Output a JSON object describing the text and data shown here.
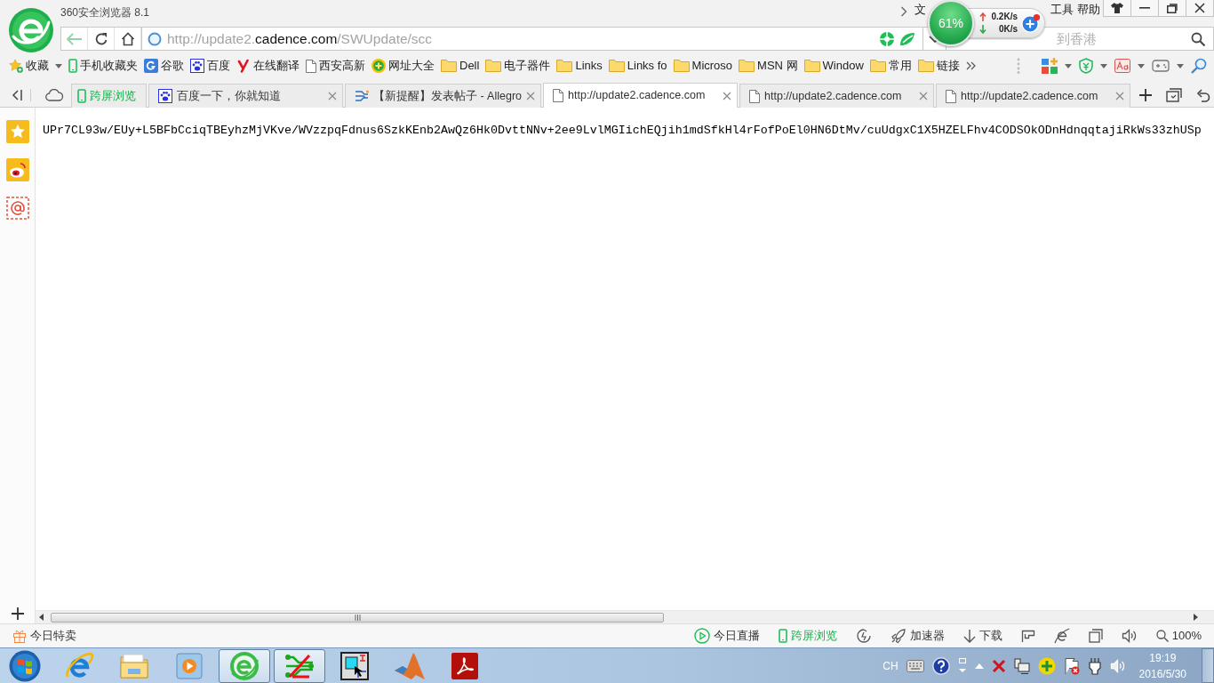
{
  "window": {
    "title": "360安全浏览器 8.1",
    "menu": [
      "文",
      "工具",
      "帮助"
    ]
  },
  "net_monitor": {
    "percent": "61%",
    "upload": "0.2K/s",
    "download": "0K/s"
  },
  "address_bar": {
    "url": [
      {
        "text": "http://update2.",
        "kind": "dim"
      },
      {
        "text": "cadence.com",
        "kind": "host"
      },
      {
        "text": "/SWUpdate/scc",
        "kind": "dim"
      }
    ]
  },
  "search": {
    "placeholder": "到香港"
  },
  "bookmarks": [
    {
      "label": "收藏",
      "kind": "favorites"
    },
    {
      "label": "手机收藏夹",
      "kind": "mobile"
    },
    {
      "label": "谷歌",
      "kind": "site"
    },
    {
      "label": "百度",
      "kind": "site"
    },
    {
      "label": "在线翻译",
      "kind": "site"
    },
    {
      "label": "西安高新",
      "kind": "page"
    },
    {
      "label": "网址大全",
      "kind": "site"
    },
    {
      "label": "Dell",
      "kind": "folder"
    },
    {
      "label": "电子器件",
      "kind": "folder"
    },
    {
      "label": "Links",
      "kind": "folder"
    },
    {
      "label": "Links fo",
      "kind": "folder"
    },
    {
      "label": "Microso",
      "kind": "folder"
    },
    {
      "label": "MSN 网",
      "kind": "folder"
    },
    {
      "label": "Window",
      "kind": "folder"
    },
    {
      "label": "常用",
      "kind": "folder"
    },
    {
      "label": "链接",
      "kind": "folder"
    }
  ],
  "tabs": [
    {
      "label": "跨屏浏览",
      "kind": "feature",
      "selected": false
    },
    {
      "label": "百度一下，你就知道",
      "kind": "page",
      "selected": false
    },
    {
      "label": "【新提醒】发表帖子 - Allegro",
      "kind": "page",
      "selected": false
    },
    {
      "label": "http://update2.cadence.com",
      "kind": "page",
      "selected": true
    },
    {
      "label": "http://update2.cadence.com",
      "kind": "page",
      "selected": false
    },
    {
      "label": "http://update2.cadence.com",
      "kind": "page",
      "selected": false
    }
  ],
  "page": {
    "text": "UPr7CL93w/EUy+L5BFbCciqTBEyhzMjVKve/WVzzpqFdnus6SzkKEnb2AwQz6Hk0DvttNNv+2ee9LvlMGIichEQjih1mdSfkHl4rFofPoEl0HN6DtMv/cuUdgxC1X5HZELFhv4CODSOkODnHdnqqtajiRkWs33zhUSp"
  },
  "status_bar": {
    "promo": "今日特卖",
    "live": "今日直播",
    "cross_screen": "跨屏浏览",
    "accelerator": "加速器",
    "download": "下载",
    "zoom": "100%"
  },
  "taskbar": {
    "apps": [
      {
        "selected": false
      },
      {
        "selected": false
      },
      {
        "selected": false
      },
      {
        "selected": true
      },
      {
        "selected": true
      },
      {
        "selected": false
      },
      {
        "selected": false
      },
      {
        "selected": false
      }
    ],
    "ime": "CH",
    "time": "19:19",
    "date": "2016/5/30"
  }
}
